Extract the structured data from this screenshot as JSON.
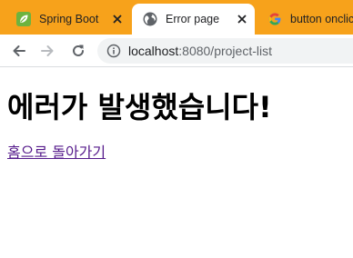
{
  "tabs": [
    {
      "title": "Spring Boot",
      "favicon": "leaf-icon",
      "state": "inactive"
    },
    {
      "title": "Error page",
      "favicon": "globe-icon",
      "state": "active"
    },
    {
      "title": "button onclick",
      "favicon": "google-icon",
      "state": "inactive"
    }
  ],
  "toolbar": {
    "url_host": "localhost",
    "url_rest": ":8080/project-list",
    "icons": [
      "back-arrow-icon",
      "forward-arrow-icon",
      "reload-icon",
      "info-icon"
    ]
  },
  "page": {
    "heading": "에러가 발생했습니다!",
    "link_text": "홈으로 돌아가기"
  },
  "colors": {
    "tab_strip": "#f7a21b",
    "active_tab": "#ffffff",
    "link_visited": "#551a8b",
    "spring_green": "#6db33f"
  }
}
